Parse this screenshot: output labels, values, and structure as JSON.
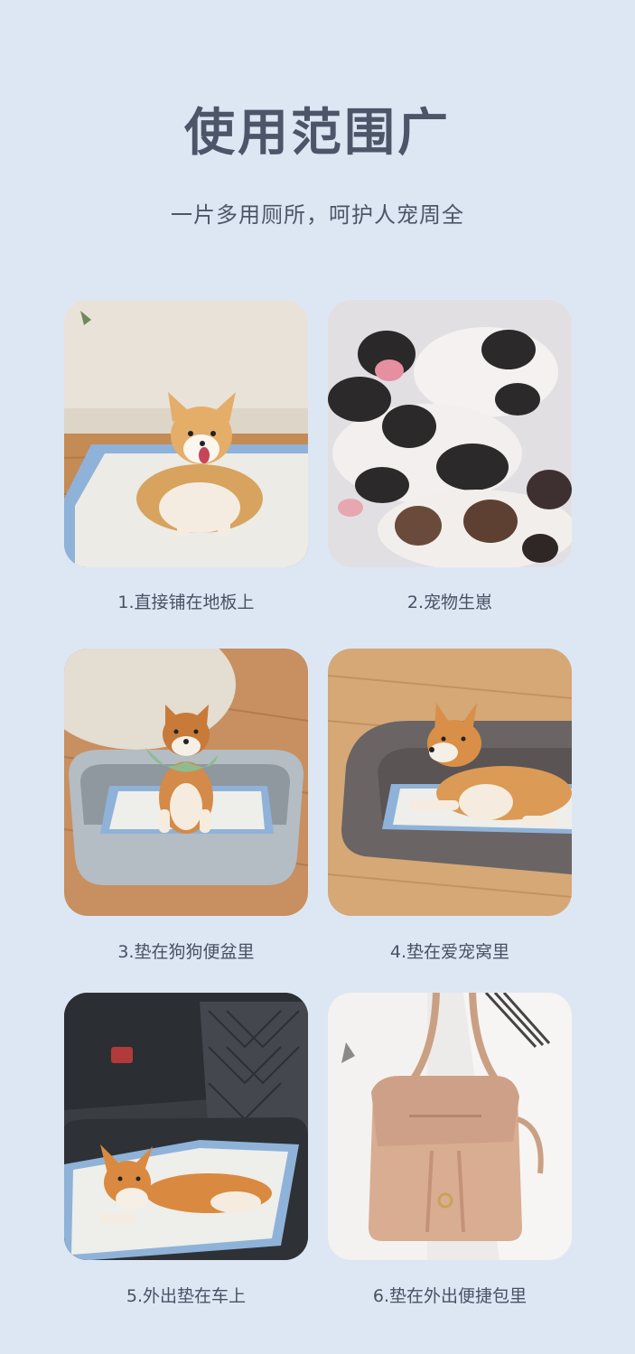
{
  "header": {
    "title": "使用范围广",
    "subtitle": "一片多用厕所，呵护人宠周全"
  },
  "scenes": [
    {
      "caption": "1.直接铺在地板上",
      "icon": "corgi-on-pad-photo"
    },
    {
      "caption": "2.宠物生崽",
      "icon": "newborn-puppies-photo"
    },
    {
      "caption": "3.垫在狗狗便盆里",
      "icon": "shiba-in-litter-tray-photo"
    },
    {
      "caption": "4.垫在爱宠窝里",
      "icon": "shiba-in-pet-bed-photo"
    },
    {
      "caption": "5.外出垫在车上",
      "icon": "corgi-on-car-seat-photo"
    },
    {
      "caption": "6.垫在外出便捷包里",
      "icon": "handbag-photo"
    }
  ],
  "colors": {
    "background": "#dde7f4",
    "title": "#4d5568",
    "pad_blue": "#8fb2d8",
    "pad_white": "#eeeeea"
  }
}
